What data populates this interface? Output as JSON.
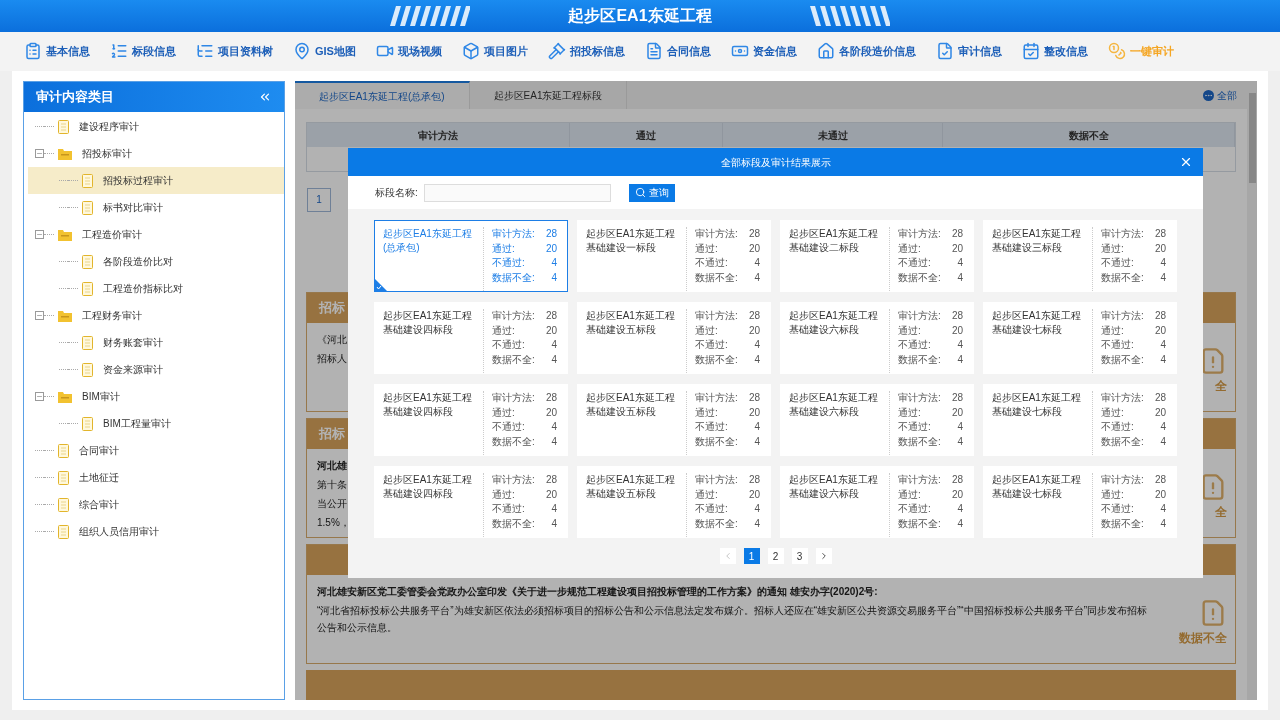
{
  "header": {
    "title": "起步区EA1东延工程"
  },
  "toolbar": [
    {
      "label": "基本信息",
      "selected": false
    },
    {
      "label": "标段信息",
      "selected": false
    },
    {
      "label": "项目资料树",
      "selected": false
    },
    {
      "label": "GIS地图",
      "selected": false
    },
    {
      "label": "现场视频",
      "selected": false
    },
    {
      "label": "项目图片",
      "selected": false
    },
    {
      "label": "招投标信息",
      "selected": false
    },
    {
      "label": "合同信息",
      "selected": false
    },
    {
      "label": "资金信息",
      "selected": false
    },
    {
      "label": "各阶段造价信息",
      "selected": false
    },
    {
      "label": "审计信息",
      "selected": false
    },
    {
      "label": "整改信息",
      "selected": false
    },
    {
      "label": "一键审计",
      "selected": true
    }
  ],
  "sidebar": {
    "title": "审计内容类目",
    "tree": [
      {
        "label": "建设程序审计",
        "selected": false
      },
      {
        "label": "招投标审计",
        "selected": false,
        "expanded": true,
        "children": [
          {
            "label": "招投标过程审计",
            "selected": true
          },
          {
            "label": "标书对比审计",
            "selected": false
          }
        ]
      },
      {
        "label": "工程造价审计",
        "selected": false,
        "expanded": true,
        "children": [
          {
            "label": "各阶段造价比对",
            "selected": false
          },
          {
            "label": "工程造价指标比对",
            "selected": false
          }
        ]
      },
      {
        "label": "工程财务审计",
        "selected": false,
        "expanded": true,
        "children": [
          {
            "label": "财务账套审计",
            "selected": false
          },
          {
            "label": "资金来源审计",
            "selected": false
          }
        ]
      },
      {
        "label": "BIM审计",
        "selected": false,
        "expanded": true,
        "children": [
          {
            "label": "BIM工程量审计",
            "selected": false
          }
        ]
      },
      {
        "label": "合同审计",
        "selected": false
      },
      {
        "label": "土地征迁",
        "selected": false
      },
      {
        "label": "综合审计",
        "selected": false
      },
      {
        "label": "组织人员信用审计",
        "selected": false
      }
    ]
  },
  "content": {
    "tabs": [
      {
        "label": "起步区EA1东延工程(总承包)",
        "selected": true
      },
      {
        "label": "起步区EA1东延工程标段",
        "selected": false
      }
    ],
    "all_button": "全部",
    "table": {
      "columns": [
        "审计方法",
        "通过",
        "未通过",
        "数据不全"
      ]
    },
    "pager": "1",
    "sections": [
      {
        "title": "招标",
        "lines": [
          {
            "text": "《河北",
            "bold": false
          },
          {
            "text": "招标人",
            "bold": false
          }
        ],
        "status": "全"
      },
      {
        "title": "招标",
        "lines": [
          {
            "text": "河北雄",
            "bold": true
          },
          {
            "text": "第十条",
            "bold": false
          },
          {
            "text": "当公开",
            "bold": false
          },
          {
            "text": "1.5%，",
            "bold": false
          }
        ],
        "status": "全"
      },
      {
        "lines": [
          {
            "text": "河北雄安新区党工委管委会党政办公室印发《关于进一步规范工程建设项目招投标管理的工作方案》的通知 雄安办字(2020)2号:",
            "bold": true
          },
          {
            "text": "“河北省招标投标公共服务平台”为雄安新区依法必须招标项目的招标公告和公示信息法定发布媒介。招标人还应在“雄安新区公共资源交易服务平台”“中国招标投标公共服务平台”同步发布招标公告和公示信息。",
            "bold": false
          }
        ],
        "status": "数据不全"
      }
    ]
  },
  "dialog": {
    "title": "全部标段及审计结果展示",
    "search_label": "标段名称:",
    "search_button": "查询",
    "cards": [
      {
        "name": "起步区EA1东延工程(总承包)",
        "selected": true,
        "stats": [
          {
            "label": "审计方法:",
            "value": "28"
          },
          {
            "label": "通过:",
            "value": "20"
          },
          {
            "label": "不通过:",
            "value": "4"
          },
          {
            "label": "数据不全:",
            "value": "4"
          }
        ]
      },
      {
        "name": "起步区EA1东延工程基础建设一标段",
        "selected": false,
        "stats": [
          {
            "label": "审计方法:",
            "value": "28"
          },
          {
            "label": "通过:",
            "value": "20"
          },
          {
            "label": "不通过:",
            "value": "4"
          },
          {
            "label": "数据不全:",
            "value": "4"
          }
        ]
      },
      {
        "name": "起步区EA1东延工程基础建设二标段",
        "selected": false,
        "stats": [
          {
            "label": "审计方法:",
            "value": "28"
          },
          {
            "label": "通过:",
            "value": "20"
          },
          {
            "label": "不通过:",
            "value": "4"
          },
          {
            "label": "数据不全:",
            "value": "4"
          }
        ]
      },
      {
        "name": "起步区EA1东延工程基础建设三标段",
        "selected": false,
        "stats": [
          {
            "label": "审计方法:",
            "value": "28"
          },
          {
            "label": "通过:",
            "value": "20"
          },
          {
            "label": "不通过:",
            "value": "4"
          },
          {
            "label": "数据不全:",
            "value": "4"
          }
        ]
      },
      {
        "name": "起步区EA1东延工程基础建设四标段",
        "selected": false,
        "stats": [
          {
            "label": "审计方法:",
            "value": "28"
          },
          {
            "label": "通过:",
            "value": "20"
          },
          {
            "label": "不通过:",
            "value": "4"
          },
          {
            "label": "数据不全:",
            "value": "4"
          }
        ]
      },
      {
        "name": "起步区EA1东延工程基础建设五标段",
        "selected": false,
        "stats": [
          {
            "label": "审计方法:",
            "value": "28"
          },
          {
            "label": "通过:",
            "value": "20"
          },
          {
            "label": "不通过:",
            "value": "4"
          },
          {
            "label": "数据不全:",
            "value": "4"
          }
        ]
      },
      {
        "name": "起步区EA1东延工程基础建设六标段",
        "selected": false,
        "stats": [
          {
            "label": "审计方法:",
            "value": "28"
          },
          {
            "label": "通过:",
            "value": "20"
          },
          {
            "label": "不通过:",
            "value": "4"
          },
          {
            "label": "数据不全:",
            "value": "4"
          }
        ]
      },
      {
        "name": "起步区EA1东延工程基础建设七标段",
        "selected": false,
        "stats": [
          {
            "label": "审计方法:",
            "value": "28"
          },
          {
            "label": "通过:",
            "value": "20"
          },
          {
            "label": "不通过:",
            "value": "4"
          },
          {
            "label": "数据不全:",
            "value": "4"
          }
        ]
      },
      {
        "name": "起步区EA1东延工程基础建设四标段",
        "selected": false,
        "stats": [
          {
            "label": "审计方法:",
            "value": "28"
          },
          {
            "label": "通过:",
            "value": "20"
          },
          {
            "label": "不通过:",
            "value": "4"
          },
          {
            "label": "数据不全:",
            "value": "4"
          }
        ]
      },
      {
        "name": "起步区EA1东延工程基础建设五标段",
        "selected": false,
        "stats": [
          {
            "label": "审计方法:",
            "value": "28"
          },
          {
            "label": "通过:",
            "value": "20"
          },
          {
            "label": "不通过:",
            "value": "4"
          },
          {
            "label": "数据不全:",
            "value": "4"
          }
        ]
      },
      {
        "name": "起步区EA1东延工程基础建设六标段",
        "selected": false,
        "stats": [
          {
            "label": "审计方法:",
            "value": "28"
          },
          {
            "label": "通过:",
            "value": "20"
          },
          {
            "label": "不通过:",
            "value": "4"
          },
          {
            "label": "数据不全:",
            "value": "4"
          }
        ]
      },
      {
        "name": "起步区EA1东延工程基础建设七标段",
        "selected": false,
        "stats": [
          {
            "label": "审计方法:",
            "value": "28"
          },
          {
            "label": "通过:",
            "value": "20"
          },
          {
            "label": "不通过:",
            "value": "4"
          },
          {
            "label": "数据不全:",
            "value": "4"
          }
        ]
      },
      {
        "name": "起步区EA1东延工程基础建设四标段",
        "selected": false,
        "stats": [
          {
            "label": "审计方法:",
            "value": "28"
          },
          {
            "label": "通过:",
            "value": "20"
          },
          {
            "label": "不通过:",
            "value": "4"
          },
          {
            "label": "数据不全:",
            "value": "4"
          }
        ]
      },
      {
        "name": "起步区EA1东延工程基础建设五标段",
        "selected": false,
        "stats": [
          {
            "label": "审计方法:",
            "value": "28"
          },
          {
            "label": "通过:",
            "value": "20"
          },
          {
            "label": "不通过:",
            "value": "4"
          },
          {
            "label": "数据不全:",
            "value": "4"
          }
        ]
      },
      {
        "name": "起步区EA1东延工程基础建设六标段",
        "selected": false,
        "stats": [
          {
            "label": "审计方法:",
            "value": "28"
          },
          {
            "label": "通过:",
            "value": "20"
          },
          {
            "label": "不通过:",
            "value": "4"
          },
          {
            "label": "数据不全:",
            "value": "4"
          }
        ]
      },
      {
        "name": "起步区EA1东延工程基础建设七标段",
        "selected": false,
        "stats": [
          {
            "label": "审计方法:",
            "value": "28"
          },
          {
            "label": "通过:",
            "value": "20"
          },
          {
            "label": "不通过:",
            "value": "4"
          },
          {
            "label": "数据不全:",
            "value": "4"
          }
        ]
      }
    ],
    "pages": [
      {
        "label": "1",
        "selected": true
      },
      {
        "label": "2",
        "selected": false
      },
      {
        "label": "3",
        "selected": false
      }
    ]
  }
}
